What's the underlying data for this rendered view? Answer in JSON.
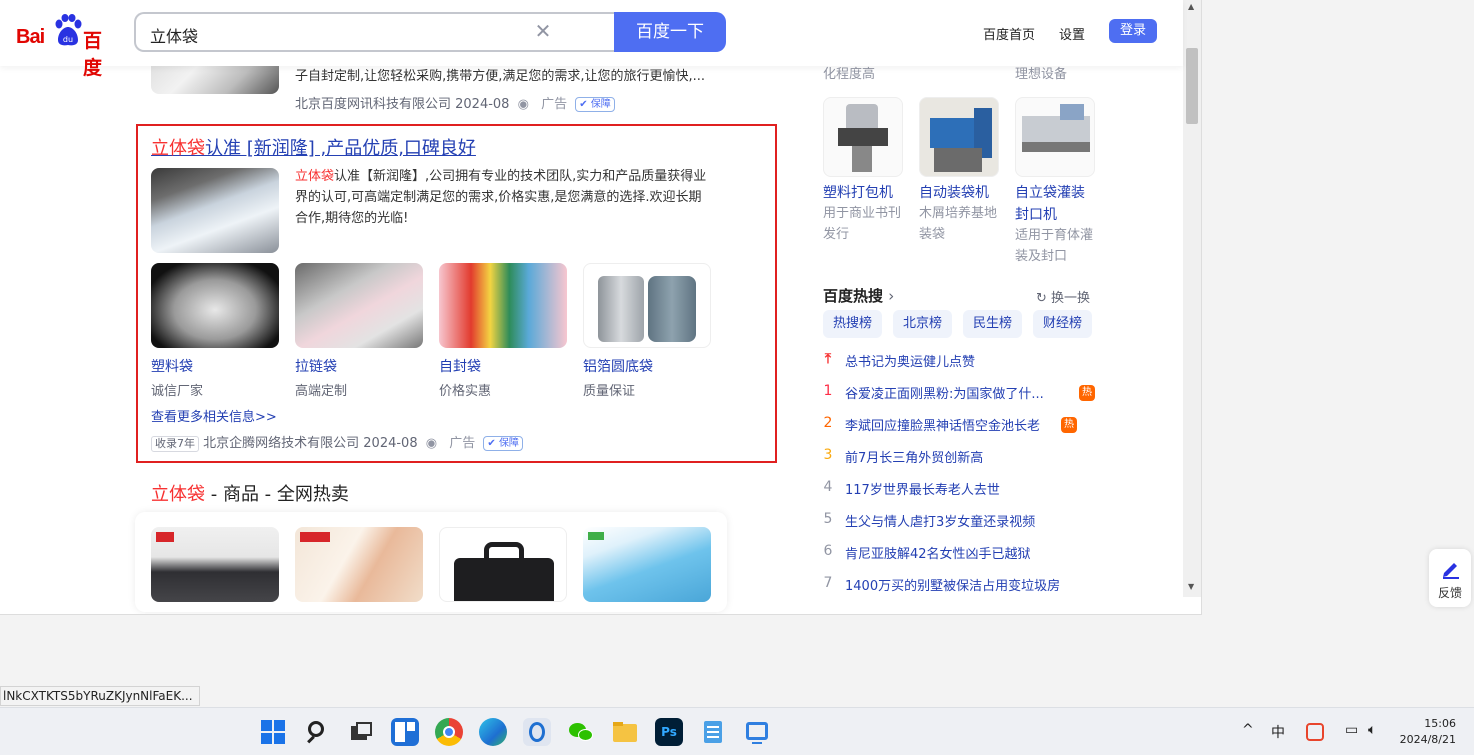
{
  "header": {
    "logo_text": "Bai",
    "logo_cn": "百度",
    "search_value": "立体袋",
    "search_button": "百度一下",
    "links": [
      "百度首页",
      "设置"
    ],
    "login": "登录"
  },
  "results": {
    "prev": {
      "snippet": "子自封定制,让您轻松采购,携带方便,满足您的需求,让您的旅行更愉快,...",
      "source": "北京百度网讯科技有限公司 2024-08",
      "ad": "广告",
      "bao": "保障"
    },
    "ad": {
      "title_red": "立体袋",
      "title_rest": "认准 [新润隆] ,产品优质,口碑良好",
      "snippet_red": "立体袋",
      "snippet_rest": "认准【新润隆】,公司拥有专业的技术团队,实力和产品质量获得业",
      "snippet_line2": "界的认可,可高端定制满足您的需求,价格实惠,是您满意的选择.欢迎长期",
      "snippet_line3": "合作,期待您的光临!",
      "products": [
        {
          "name": "塑料袋",
          "sub": "诚信厂家"
        },
        {
          "name": "拉链袋",
          "sub": "高端定制"
        },
        {
          "name": "自封袋",
          "sub": "价格实惠"
        },
        {
          "name": "铝箔圆底袋",
          "sub": "质量保证"
        }
      ],
      "see_more": "查看更多相关信息>>",
      "tag": "收录7年",
      "source": "北京企腾网络技术有限公司 2024-08",
      "ad": "广告",
      "bao": "保障"
    },
    "shop": {
      "title_red": "立体袋",
      "title_rest": " - 商品 - 全网热卖"
    }
  },
  "right": {
    "top_desc": [
      "化程度高",
      "理想设备"
    ],
    "machines": [
      {
        "title": "塑料打包机",
        "desc": [
          "用于商业书刊",
          "发行"
        ]
      },
      {
        "title": "自动装袋机",
        "desc": [
          "木屑培养基地",
          "装袋"
        ]
      },
      {
        "title": "自立袋灌装",
        "title2": "封口机",
        "desc": [
          "适用于育体灌",
          "装及封口"
        ]
      }
    ],
    "hot": {
      "heading": "百度热搜",
      "refresh": "换一换",
      "tabs": [
        "热搜榜",
        "北京榜",
        "民生榜",
        "财经榜"
      ],
      "items": [
        {
          "rank": "",
          "text": "总书记为奥运健儿点赞",
          "badge": ""
        },
        {
          "rank": "1",
          "text": "谷爱凌正面刚黑粉:为国家做了什...",
          "badge": "热"
        },
        {
          "rank": "2",
          "text": "李斌回应撞脸黑神话悟空金池长老",
          "badge": "热"
        },
        {
          "rank": "3",
          "text": "前7月长三角外贸创新高",
          "badge": ""
        },
        {
          "rank": "4",
          "text": "117岁世界最长寿老人去世",
          "badge": ""
        },
        {
          "rank": "5",
          "text": "生父与情人虐打3岁女童还录视频",
          "badge": ""
        },
        {
          "rank": "6",
          "text": "肯尼亚肢解42名女性凶手已越狱",
          "badge": ""
        },
        {
          "rank": "7",
          "text": "1400万买的别墅被保洁占用变垃圾房",
          "badge": ""
        }
      ]
    }
  },
  "feedback": "反馈",
  "status_url": "lNkCXTKTS5bYRuZKJynNlFaEK...",
  "clock": {
    "time": "15:06",
    "date": "2024/8/21"
  },
  "tray": {
    "ime": "中"
  }
}
